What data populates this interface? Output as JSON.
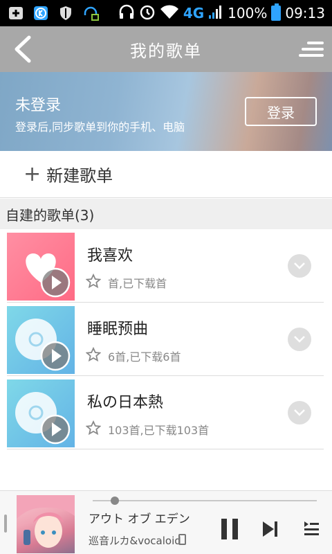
{
  "status_bar": {
    "network": "4G",
    "battery": "100%",
    "time": "09:13",
    "icons": [
      "add-notification-icon",
      "app-k-icon",
      "shield-icon",
      "headset-update-icon",
      "headphones-icon",
      "alarm-icon",
      "wifi-icon",
      "signal-icon",
      "battery-icon"
    ]
  },
  "title_bar": {
    "title": "我的歌单"
  },
  "banner": {
    "title": "未登录",
    "subtitle": "登录后,同步歌单到你的手机、电脑",
    "login_label": "登录"
  },
  "new_playlist": {
    "label": "新建歌单"
  },
  "section": {
    "title": "自建的歌单(3)"
  },
  "playlists": [
    {
      "name": "我喜欢",
      "meta": "首,已下载首",
      "thumb": "heart"
    },
    {
      "name": "睡眠预曲",
      "meta": "6首,已下载6首",
      "thumb": "disc"
    },
    {
      "name": "私の日本熱",
      "meta": "103首,已下载103首",
      "thumb": "disc"
    }
  ],
  "player": {
    "song": "アウト オブ エデン",
    "artist": "巡音ルカ&vocaloid",
    "progress": 0.1
  },
  "colors": {
    "title_bar_bg": "#a8a8a8",
    "accent_blue": "#2fa4ff",
    "pink_thumb": "#ff7f98",
    "blue_thumb": "#6fc6e8"
  }
}
